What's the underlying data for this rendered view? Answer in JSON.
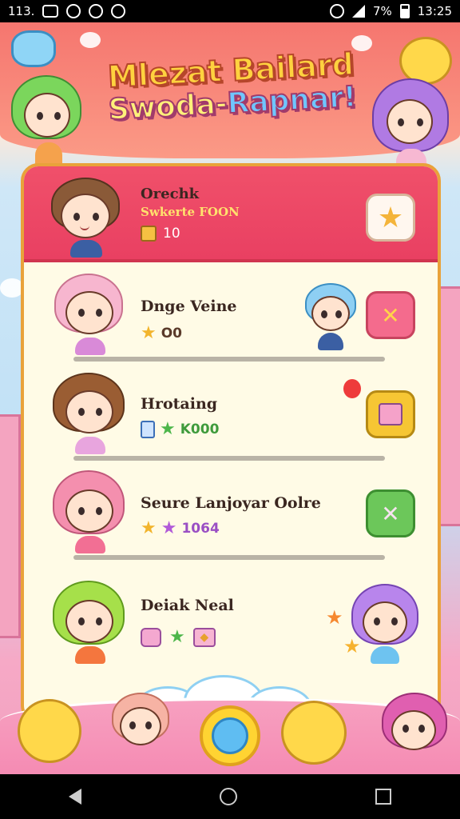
{
  "status_bar": {
    "left_text": "113.",
    "right_signal_text": "7%",
    "time": "13:25"
  },
  "title": {
    "line1": "Mlezat Bailard",
    "line2_a": "Swoda-",
    "line2_b": "Rapnar!"
  },
  "player": {
    "name": "Orechk",
    "subtitle": "Swkerte FOON",
    "coins": "10",
    "favorite_icon": "star-icon"
  },
  "rows": [
    {
      "name": "Dnge Veine",
      "stat": "O0",
      "action_icon": "cancel-icon",
      "action_color": "#f46b8d",
      "progress": 1.0
    },
    {
      "name": "Hrotaing",
      "stat": "K000",
      "action_icon": "book-icon",
      "action_color": "#f6c634",
      "progress": 1.0
    },
    {
      "name": "Seure Lanjoyar Oolre",
      "stat": "1064",
      "action_icon": "tools-icon",
      "action_color": "#6cc75a",
      "progress": 1.0
    },
    {
      "name": "Deiak Neal",
      "stat": "",
      "action_icon": "",
      "action_color": "",
      "progress": 0
    }
  ],
  "colors": {
    "panel_head": "#e94062",
    "panel_border": "#e9a23a",
    "accent_yellow": "#ffd432"
  }
}
